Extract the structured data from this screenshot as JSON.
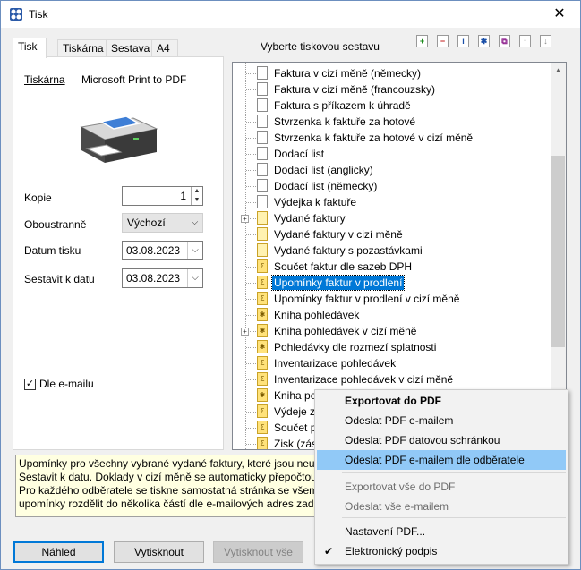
{
  "window": {
    "title": "Tisk",
    "close_label": "✕"
  },
  "tabs": [
    {
      "label": "Tisk",
      "active": true
    },
    {
      "label": "Tiskárna",
      "active": false
    },
    {
      "label": "Sestava",
      "active": false
    },
    {
      "label": "A4",
      "active": false
    }
  ],
  "print_tab": {
    "printer_label": "Tiskárna",
    "printer_value": "Microsoft Print to PDF",
    "copies_label": "Kopie",
    "copies_value": "1",
    "duplex_label": "Oboustranně",
    "duplex_value": "Výchozí",
    "print_date_label": "Datum tisku",
    "print_date_value": "03.08.2023",
    "build_date_label": "Sestavit k datu",
    "build_date_value": "03.08.2023",
    "email_checkbox_label": "Dle e-mailu",
    "email_checkbox_checked": true
  },
  "report_panel": {
    "caption": "Vyberte tiskovou sestavu",
    "toolbar_icons": [
      "add-icon",
      "remove-icon",
      "info-icon",
      "star-icon",
      "copy-icon",
      "move-up-icon",
      "move-down-icon"
    ],
    "items": [
      {
        "label": "Faktura v cizí měně (německy)",
        "icon": "document-icon",
        "expandable": false,
        "selected": false
      },
      {
        "label": "Faktura v cizí měně (francouzsky)",
        "icon": "document-icon",
        "expandable": false,
        "selected": false
      },
      {
        "label": "Faktura s příkazem k úhradě",
        "icon": "document-icon",
        "expandable": false,
        "selected": false
      },
      {
        "label": "Stvrzenka k faktuře za hotové",
        "icon": "document-icon",
        "expandable": false,
        "selected": false
      },
      {
        "label": "Stvrzenka k faktuře za hotové v cizí měně",
        "icon": "document-icon",
        "expandable": false,
        "selected": false
      },
      {
        "label": "Dodací list",
        "icon": "document-icon",
        "expandable": false,
        "selected": false
      },
      {
        "label": "Dodací list (anglicky)",
        "icon": "document-icon",
        "expandable": false,
        "selected": false
      },
      {
        "label": "Dodací list (německy)",
        "icon": "document-icon",
        "expandable": false,
        "selected": false
      },
      {
        "label": "Výdejka k faktuře",
        "icon": "document-icon",
        "expandable": false,
        "selected": false
      },
      {
        "label": "Vydané faktury",
        "icon": "list-icon",
        "expandable": true,
        "selected": false
      },
      {
        "label": "Vydané faktury v cizí měně",
        "icon": "list-icon",
        "expandable": false,
        "selected": false
      },
      {
        "label": "Vydané faktury s pozastávkami",
        "icon": "list-icon",
        "expandable": false,
        "selected": false
      },
      {
        "label": "Součet faktur dle sazeb DPH",
        "icon": "sum-icon",
        "expandable": false,
        "selected": false
      },
      {
        "label": "Upomínky faktur v prodlení",
        "icon": "sum-icon",
        "expandable": false,
        "selected": true
      },
      {
        "label": "Upomínky faktur v prodlení v cizí měně",
        "icon": "sum-icon",
        "expandable": false,
        "selected": false
      },
      {
        "label": "Kniha pohledávek",
        "icon": "star-icon",
        "expandable": false,
        "selected": false
      },
      {
        "label": "Kniha pohledávek v cizí měně",
        "icon": "star-icon",
        "expandable": true,
        "selected": false
      },
      {
        "label": "Pohledávky dle rozmezí splatnosti",
        "icon": "star-icon",
        "expandable": false,
        "selected": false
      },
      {
        "label": "Inventarizace pohledávek",
        "icon": "sum-icon",
        "expandable": false,
        "selected": false
      },
      {
        "label": "Inventarizace pohledávek v cizí měně",
        "icon": "sum-icon",
        "expandable": false,
        "selected": false
      },
      {
        "label": "Kniha pe",
        "icon": "star-icon",
        "expandable": false,
        "selected": false
      },
      {
        "label": "Výdeje z",
        "icon": "sum-icon",
        "expandable": false,
        "selected": false
      },
      {
        "label": "Součet p",
        "icon": "sum-icon",
        "expandable": false,
        "selected": false
      },
      {
        "label": "Zisk (zás",
        "icon": "sum-icon",
        "expandable": false,
        "selected": false
      }
    ]
  },
  "description": [
    "Upomínky pro všechny vybrané vydané faktury, které jsou neu",
    "Sestavit k datu. Doklady v cizí měně se automaticky přepočtou",
    "Pro každého odběratele se tiskne samostatná stránka se všemi",
    "upomínky rozdělit do několika částí dle e-mailových adres zad"
  ],
  "buttons": {
    "preview": "Náhled",
    "print": "Vytisknout",
    "print_all": "Vytisknout vše"
  },
  "context_menu": {
    "items": [
      {
        "label": "Exportovat do PDF",
        "bold": true,
        "disabled": false,
        "hover": false,
        "checked": false
      },
      {
        "label": "Odeslat PDF e-mailem",
        "bold": false,
        "disabled": false,
        "hover": false,
        "checked": false
      },
      {
        "label": "Odeslat PDF datovou schránkou",
        "bold": false,
        "disabled": false,
        "hover": false,
        "checked": false
      },
      {
        "label": "Odeslat PDF e-mailem dle odběratele",
        "bold": false,
        "disabled": false,
        "hover": true,
        "checked": false
      },
      {
        "label": "Exportovat vše do PDF",
        "bold": false,
        "disabled": true,
        "hover": false,
        "checked": false
      },
      {
        "label": "Odeslat vše e-mailem",
        "bold": false,
        "disabled": true,
        "hover": false,
        "checked": false
      },
      {
        "label": "Nastavení PDF...",
        "bold": false,
        "disabled": false,
        "hover": false,
        "checked": false
      },
      {
        "label": "Elektronický podpis",
        "bold": false,
        "disabled": false,
        "hover": false,
        "checked": true
      }
    ]
  },
  "colors": {
    "accent": "#0078d7",
    "hover": "#91c9f7",
    "description_bg": "#ffffe1"
  }
}
